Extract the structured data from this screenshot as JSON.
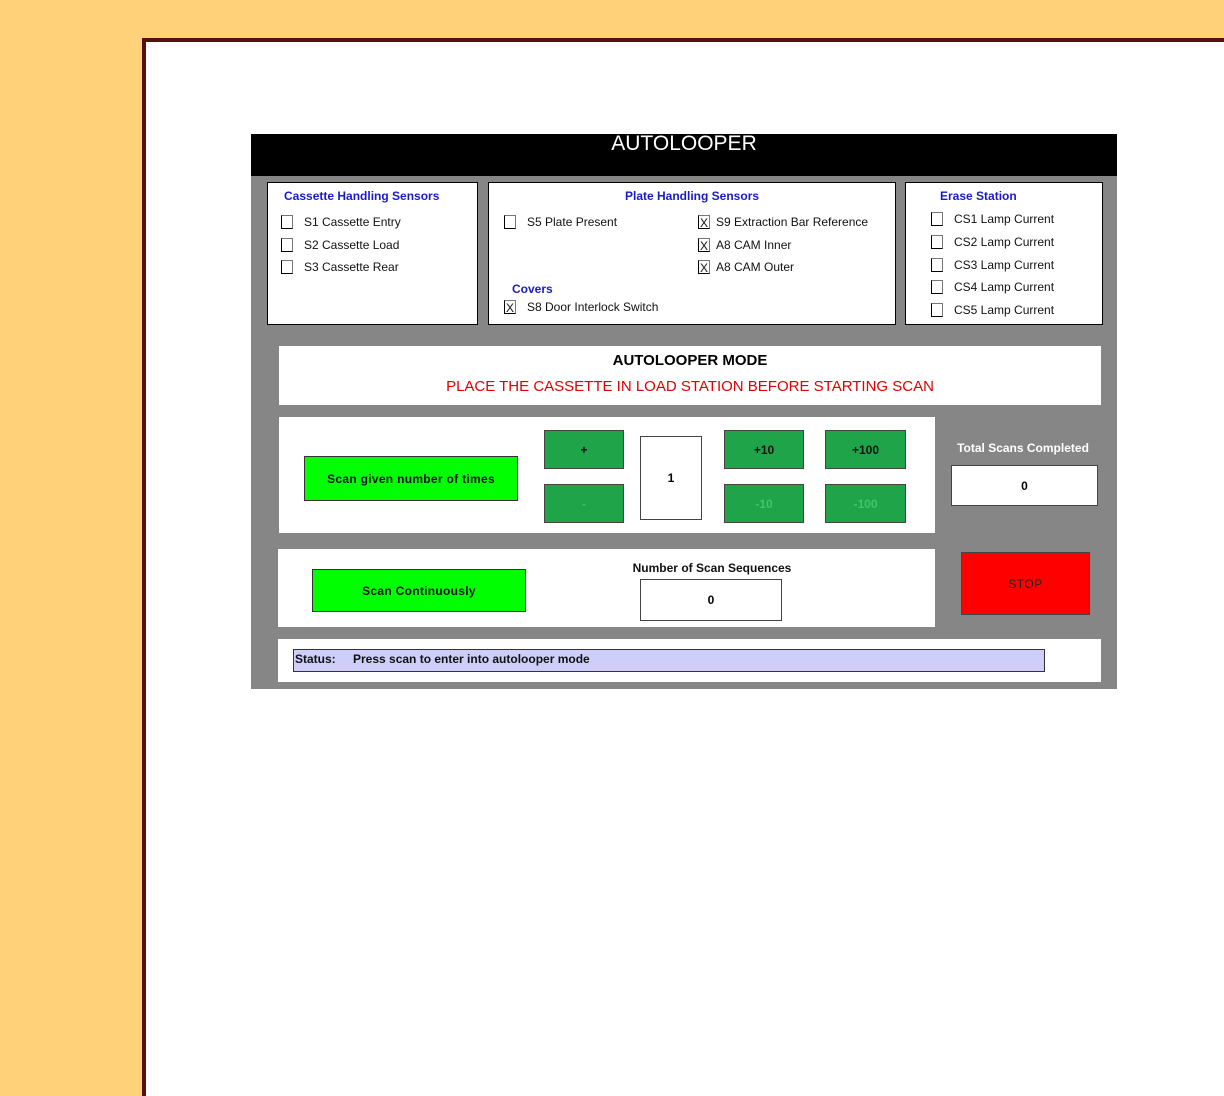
{
  "app": {
    "title": "AUTOLOOPER"
  },
  "cassette": {
    "title": "Cassette Handling Sensors",
    "items": [
      {
        "label": "S1 Cassette Entry",
        "mark": ""
      },
      {
        "label": "S2 Cassette Load",
        "mark": ""
      },
      {
        "label": "S3 Cassette Rear",
        "mark": ""
      }
    ]
  },
  "plate": {
    "title": "Plate Handling Sensors",
    "left_items": [
      {
        "label": "S5 Plate Present",
        "mark": ""
      }
    ],
    "right_items": [
      {
        "label": "S9 Extraction Bar Reference",
        "mark": "X"
      },
      {
        "label": "A8 CAM Inner",
        "mark": "X"
      },
      {
        "label": "A8 CAM Outer",
        "mark": "X"
      }
    ],
    "covers_title": "Covers",
    "covers_items": [
      {
        "label": "S8 Door Interlock Switch",
        "mark": "X"
      }
    ]
  },
  "erase": {
    "title": "Erase Station",
    "items": [
      {
        "label": "CS1 Lamp Current",
        "mark": ""
      },
      {
        "label": "CS2 Lamp Current",
        "mark": ""
      },
      {
        "label": "CS3 Lamp Current",
        "mark": ""
      },
      {
        "label": "CS4 Lamp Current",
        "mark": ""
      },
      {
        "label": "CS5 Lamp Current",
        "mark": ""
      }
    ]
  },
  "mode": {
    "heading": "AUTOLOOPER MODE",
    "message": "PLACE THE CASSETTE IN LOAD STATION BEFORE STARTING SCAN",
    "message_color": "#e00000"
  },
  "scan_count": {
    "button_label": "Scan given number of times",
    "plus": "+",
    "minus": "-",
    "plus10": "+10",
    "minus10": "-10",
    "plus100": "+100",
    "minus100": "-100",
    "value": "1"
  },
  "total": {
    "label": "Total Scans Completed",
    "value": "0"
  },
  "continuous": {
    "button_label": "Scan Continuously",
    "seq_label": "Number of Scan Sequences",
    "seq_value": "0"
  },
  "stop": {
    "label": "STOP"
  },
  "status": {
    "label": "Status:",
    "text": "Press scan to enter into autolooper mode"
  }
}
